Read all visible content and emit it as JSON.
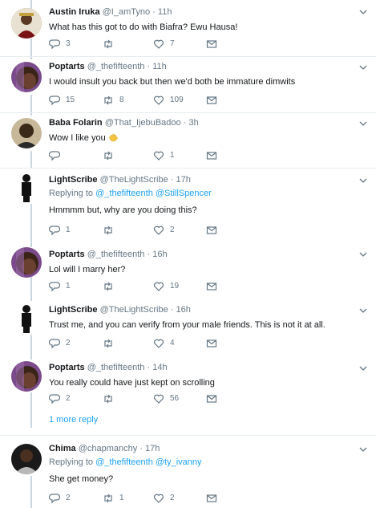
{
  "tweets": [
    {
      "name": "Austin Iruka",
      "handle": "@I_amTyno",
      "time": "11h",
      "text": "What has this got to do with Biafra? Ewu Hausa!",
      "replies": "3",
      "retweets": "",
      "likes": "7"
    },
    {
      "name": "Poptarts",
      "handle": "@_thefifteenth",
      "time": "11h",
      "text": "I would insult you back but then we'd both be immature dimwits",
      "replies": "15",
      "retweets": "8",
      "likes": "109"
    },
    {
      "name": "Baba Folarin",
      "handle": "@That_IjebuBadoo",
      "time": "3h",
      "text": "Wow I like you",
      "replies": "",
      "retweets": "",
      "likes": "1"
    },
    {
      "name": "LightScribe",
      "handle": "@TheLightScribe",
      "time": "17h",
      "replying_prefix": "Replying to",
      "replying_to_1": "@_thefifteenth",
      "replying_to_2": "@StillSpencer",
      "text": "Hmmmm but, why are you doing this?",
      "replies": "1",
      "retweets": "",
      "likes": "2"
    },
    {
      "name": "Poptarts",
      "handle": "@_thefifteenth",
      "time": "16h",
      "text": "Lol will I marry her?",
      "replies": "1",
      "retweets": "",
      "likes": "19"
    },
    {
      "name": "LightScribe",
      "handle": "@TheLightScribe",
      "time": "16h",
      "text": "Trust me, and you can verify from your male friends. This is not it at all.",
      "replies": "2",
      "retweets": "",
      "likes": "4"
    },
    {
      "name": "Poptarts",
      "handle": "@_thefifteenth",
      "time": "14h",
      "text": "You really could have just kept on scrolling",
      "replies": "2",
      "retweets": "",
      "likes": "56"
    },
    {
      "name": "Chima",
      "handle": "@chapmanchy",
      "time": "17h",
      "replying_prefix": "Replying to",
      "replying_to_1": "@_thefifteenth",
      "replying_to_2": "@ty_ivanny",
      "text": "She get money?",
      "replies": "2",
      "retweets": "1",
      "likes": "2"
    }
  ],
  "more_replies": "1 more reply",
  "dot": "·",
  "icons": {
    "reply": "reply-icon",
    "retweet": "retweet-icon",
    "like": "heart-icon",
    "dm": "envelope-icon",
    "caret": "chevron-down-icon",
    "emoji": "waving-hand-emoji"
  },
  "colors": {
    "link": "#1da1f2",
    "muted": "#657786",
    "thread": "#c8d6e2",
    "retweet_active": "#17bf63"
  }
}
